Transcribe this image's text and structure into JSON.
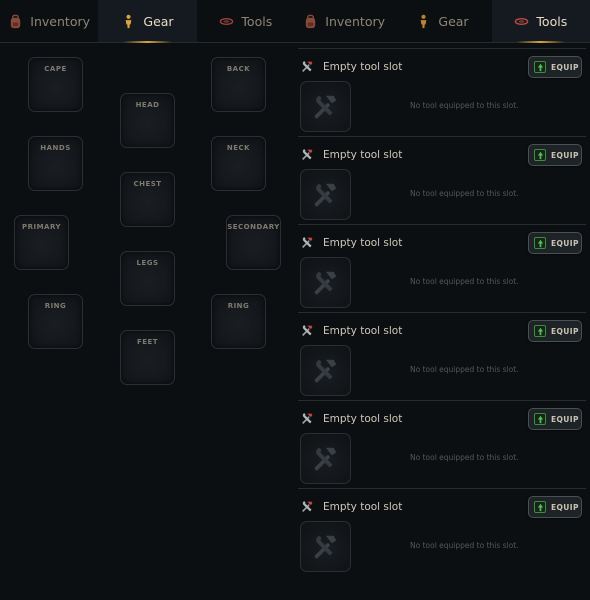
{
  "left_tabs": [
    {
      "label": "Inventory",
      "icon": "backpack-icon",
      "active": false
    },
    {
      "label": "Gear",
      "icon": "person-icon",
      "active": true
    },
    {
      "label": "Tools",
      "icon": "lens-icon",
      "active": false
    }
  ],
  "right_tabs": [
    {
      "label": "Inventory",
      "icon": "backpack-icon",
      "active": false
    },
    {
      "label": "Gear",
      "icon": "person-icon",
      "active": false
    },
    {
      "label": "Tools",
      "icon": "lens-icon",
      "active": true
    }
  ],
  "gear_slots": {
    "cape": "CAPE",
    "back": "BACK",
    "head": "HEAD",
    "hands": "HANDS",
    "neck": "NECK",
    "chest": "CHEST",
    "primary": "PRIMARY",
    "secondary": "SECONDARY",
    "legs": "LEGS",
    "ring_left": "RING",
    "ring_right": "RING",
    "feet": "FEET"
  },
  "tool_slots": [
    {
      "title": "Empty tool slot",
      "button": "EQUIP",
      "empty_text": "No tool equipped to this slot."
    },
    {
      "title": "Empty tool slot",
      "button": "EQUIP",
      "empty_text": "No tool equipped to this slot."
    },
    {
      "title": "Empty tool slot",
      "button": "EQUIP",
      "empty_text": "No tool equipped to this slot."
    },
    {
      "title": "Empty tool slot",
      "button": "EQUIP",
      "empty_text": "No tool equipped to this slot."
    },
    {
      "title": "Empty tool slot",
      "button": "EQUIP",
      "empty_text": "No tool equipped to this slot."
    },
    {
      "title": "Empty tool slot",
      "button": "EQUIP",
      "empty_text": "No tool equipped to this slot."
    }
  ],
  "colors": {
    "background": "#0c0f12",
    "accent": "#d9a441",
    "equip_green": "#3e8a3e"
  }
}
